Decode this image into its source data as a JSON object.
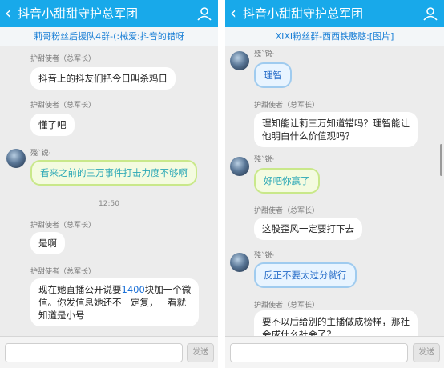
{
  "left": {
    "back_icon": "chevron-left",
    "title": "抖音小甜甜守护总军团",
    "notice": "莉哥粉丝后援队4群-(:械爱:抖音的错呀",
    "messages": [
      {
        "name": "护甜使者（总军长）",
        "text": "抖音上的抖友们把今日叫杀鸡日"
      },
      {
        "name": "护甜使者（总军长）",
        "text": "懂了吧"
      },
      {
        "name": "殘`锐·",
        "text": "看来之前的三万事件打击力度不够啊"
      },
      {
        "time": "12:50"
      },
      {
        "name": "护甜使者（总军长）",
        "text": "是啊"
      },
      {
        "name": "护甜使者（总军长）",
        "text_before": "现在她直播公开说要",
        "link": "1400",
        "text_after": "块加一个微",
        "line2": "信。你发信息她还不一定复，一看就",
        "line3": "知道是小号"
      }
    ],
    "send_label": "发送"
  },
  "right": {
    "back_icon": "chevron-left",
    "title": "抖音小甜甜守护总军团",
    "notice": "XIXI粉丝群-西西铁憨憨:[图片]",
    "messages": [
      {
        "name": "殘`锐·",
        "text": "理智"
      },
      {
        "name": "护甜使者（总军长）",
        "line1": "理知能让莉三万知道错吗？理智能让",
        "line2": "他明白什么价值观吗？"
      },
      {
        "name": "殘`锐·",
        "text": "好吧你赢了"
      },
      {
        "name": "护甜使者（总军长）",
        "text": "这股歪风一定要打下去"
      },
      {
        "name": "殘`锐·",
        "text": "反正不要太过分就行"
      },
      {
        "name": "护甜使者（总军长）",
        "line1": "要不以后给别的主播做成榜样，那社",
        "line2": "会成什么社会了？"
      }
    ],
    "send_label": "发送"
  }
}
